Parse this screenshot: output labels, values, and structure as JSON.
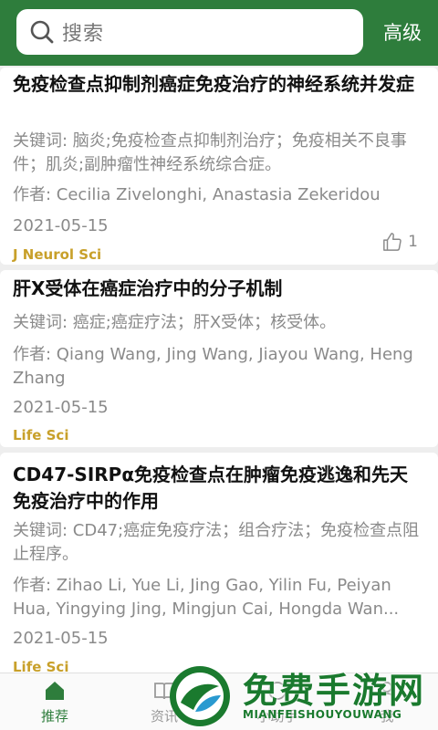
{
  "header": {
    "search_placeholder": "搜索",
    "advanced_label": "高级"
  },
  "articles": [
    {
      "title": "免疫检查点抑制剂癌症免疫治疗的神经系统并发症",
      "keywords": "关键词: 脑炎;免疫检查点抑制剂治疗；免疫相关不良事件；肌炎;副肿瘤性神经系统综合症。",
      "authors": "作者: Cecilia Zivelonghi, Anastasia Zekeridou",
      "date": "2021-05-15",
      "journal": "J Neurol Sci",
      "likes": "1"
    },
    {
      "title": "肝X受体在癌症治疗中的分子机制",
      "keywords": "关键词: 癌症;癌症疗法；肝X受体；核受体。",
      "authors": "作者: Qiang Wang, Jing Wang, Jiayou Wang, Heng Zhang",
      "date": "2021-05-15",
      "journal": "Life Sci"
    },
    {
      "title": "CD47-SIRPα免疫检查点在肿瘤免疫逃逸和先天免疫治疗中的作用",
      "keywords": "关键词: CD47;癌症免疫疗法；组合疗法；免疫检查点阻止程序。",
      "authors": "作者: Zihao Li, Yue Li, Jing Gao, Yilin Fu, Peiyan Hua, Yingying Jing, Mingjun Cai, Hongda Wan...",
      "date": "2021-05-15",
      "journal": "Life Sci"
    }
  ],
  "tabbar": {
    "tabs": [
      {
        "label": "推荐",
        "icon": "home-icon",
        "active": true
      },
      {
        "label": "资讯",
        "icon": "book-icon"
      },
      {
        "label": "",
        "icon": "placeholder"
      },
      {
        "label": "小助手",
        "icon": "assistant-icon"
      },
      {
        "label": "我",
        "icon": "user-icon"
      }
    ]
  },
  "watermark": {
    "title": "免费手游网",
    "subtitle": "MIANFEISHOUYOUWANG"
  },
  "colors": {
    "brand_green": "#2e7d3c",
    "journal_gold": "#c8a02a",
    "text_gray": "#8a8a8a"
  }
}
